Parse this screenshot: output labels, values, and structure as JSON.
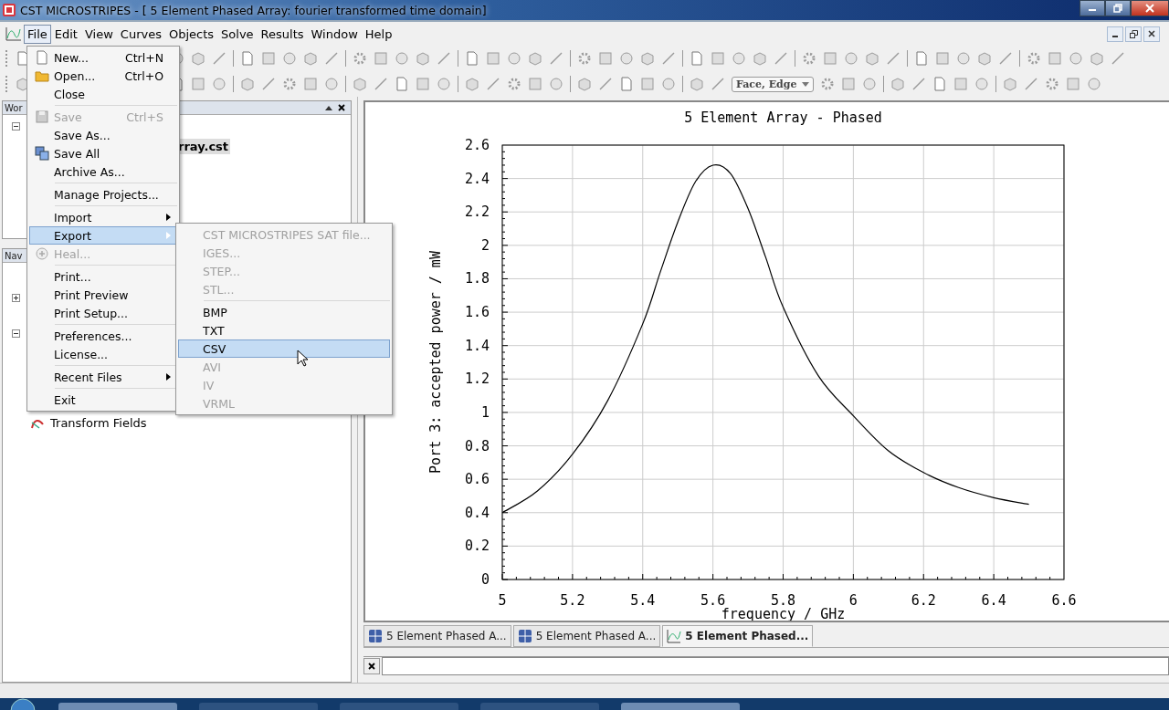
{
  "window": {
    "title": "CST MICROSTRIPES - [ 5 Element Phased Array: fourier transformed time domain]"
  },
  "menu_bar": [
    {
      "label": "File",
      "selected": true
    },
    {
      "label": "Edit",
      "selected": false
    },
    {
      "label": "View",
      "selected": false
    },
    {
      "label": "Curves",
      "selected": false
    },
    {
      "label": "Objects",
      "selected": false
    },
    {
      "label": "Solve",
      "selected": false
    },
    {
      "label": "Results",
      "selected": false
    },
    {
      "label": "Window",
      "selected": false
    },
    {
      "label": "Help",
      "selected": false
    }
  ],
  "toolbar": {
    "view_dropdown": "Face, Edge"
  },
  "workspace_panel": {
    "title": "Wor",
    "items": [
      {
        "label": "rray.cst",
        "selected": true
      }
    ]
  },
  "navigation_panel": {
    "title": "Nav",
    "items": [
      {
        "label": "Transform Fields"
      }
    ]
  },
  "file_menu": [
    {
      "kind": "item",
      "label": "New...",
      "shortcut": "Ctrl+N",
      "disabled": false,
      "selected": false
    },
    {
      "kind": "item",
      "label": "Open...",
      "shortcut": "Ctrl+O",
      "disabled": false,
      "selected": false
    },
    {
      "kind": "item",
      "label": "Close",
      "disabled": false,
      "selected": false
    },
    {
      "kind": "separator"
    },
    {
      "kind": "item",
      "label": "Save",
      "shortcut": "Ctrl+S",
      "disabled": true,
      "selected": false
    },
    {
      "kind": "item",
      "label": "Save As...",
      "disabled": false,
      "selected": false
    },
    {
      "kind": "item",
      "label": "Save All",
      "disabled": false,
      "selected": false
    },
    {
      "kind": "item",
      "label": "Archive As...",
      "disabled": false,
      "selected": false
    },
    {
      "kind": "separator"
    },
    {
      "kind": "item",
      "label": "Manage Projects...",
      "disabled": false,
      "selected": false
    },
    {
      "kind": "separator"
    },
    {
      "kind": "submenu",
      "label": "Import",
      "disabled": false,
      "selected": false
    },
    {
      "kind": "submenu",
      "label": "Export",
      "disabled": false,
      "selected": true
    },
    {
      "kind": "item",
      "label": "Heal...",
      "disabled": true,
      "selected": false
    },
    {
      "kind": "separator"
    },
    {
      "kind": "item",
      "label": "Print...",
      "disabled": false,
      "selected": false
    },
    {
      "kind": "item",
      "label": "Print Preview",
      "disabled": false,
      "selected": false
    },
    {
      "kind": "item",
      "label": "Print Setup...",
      "disabled": false,
      "selected": false
    },
    {
      "kind": "separator"
    },
    {
      "kind": "item",
      "label": "Preferences...",
      "disabled": false,
      "selected": false
    },
    {
      "kind": "item",
      "label": "License...",
      "disabled": false,
      "selected": false
    },
    {
      "kind": "separator"
    },
    {
      "kind": "submenu",
      "label": "Recent Files",
      "disabled": false,
      "selected": false
    },
    {
      "kind": "separator"
    },
    {
      "kind": "item",
      "label": "Exit",
      "disabled": false,
      "selected": false
    }
  ],
  "export_menu": [
    {
      "kind": "item",
      "label": "CST MICROSTRIPES SAT file...",
      "disabled": true,
      "selected": false
    },
    {
      "kind": "item",
      "label": "IGES...",
      "disabled": true,
      "selected": false
    },
    {
      "kind": "item",
      "label": "STEP...",
      "disabled": true,
      "selected": false
    },
    {
      "kind": "item",
      "label": "STL...",
      "disabled": true,
      "selected": false
    },
    {
      "kind": "separator"
    },
    {
      "kind": "item",
      "label": "BMP",
      "disabled": false,
      "selected": false
    },
    {
      "kind": "item",
      "label": "TXT",
      "disabled": false,
      "selected": false
    },
    {
      "kind": "item",
      "label": "CSV",
      "disabled": false,
      "selected": true
    },
    {
      "kind": "item",
      "label": "AVI",
      "disabled": true,
      "selected": false
    },
    {
      "kind": "item",
      "label": "IV",
      "disabled": true,
      "selected": false
    },
    {
      "kind": "item",
      "label": "VRML",
      "disabled": true,
      "selected": false
    }
  ],
  "plot": {
    "chart_data": {
      "type": "line",
      "title": "5 Element Array - Phased",
      "xlabel": "frequency / GHz",
      "ylabel": "Port 3: accepted power / mW",
      "x": [
        5.0,
        5.1,
        5.2,
        5.3,
        5.4,
        5.45,
        5.5,
        5.55,
        5.6,
        5.65,
        5.7,
        5.75,
        5.8,
        5.9,
        6.0,
        6.1,
        6.2,
        6.3,
        6.4,
        6.5
      ],
      "grid": true,
      "series": [
        {
          "color": "#000000",
          "values": [
            0.4,
            0.53,
            0.75,
            1.07,
            1.53,
            1.84,
            2.14,
            2.38,
            2.48,
            2.43,
            2.22,
            1.93,
            1.63,
            1.22,
            0.98,
            0.77,
            0.64,
            0.55,
            0.49,
            0.45
          ]
        }
      ],
      "xlim": [
        5,
        6.6
      ],
      "ylim": [
        0,
        2.6
      ],
      "xticks": [
        5,
        5.2,
        5.4,
        5.6,
        5.8,
        6,
        6.2,
        6.4,
        6.6
      ],
      "yticks": [
        0,
        0.2,
        0.4,
        0.6,
        0.8,
        1,
        1.2,
        1.4,
        1.6,
        1.8,
        2,
        2.2,
        2.4,
        2.6
      ]
    }
  },
  "document_tabs": [
    {
      "label": "5 Element Phased A...",
      "selected": false
    },
    {
      "label": "5 Element Phased A...",
      "selected": false
    },
    {
      "label": "5 Element Phased...",
      "selected": true
    }
  ]
}
